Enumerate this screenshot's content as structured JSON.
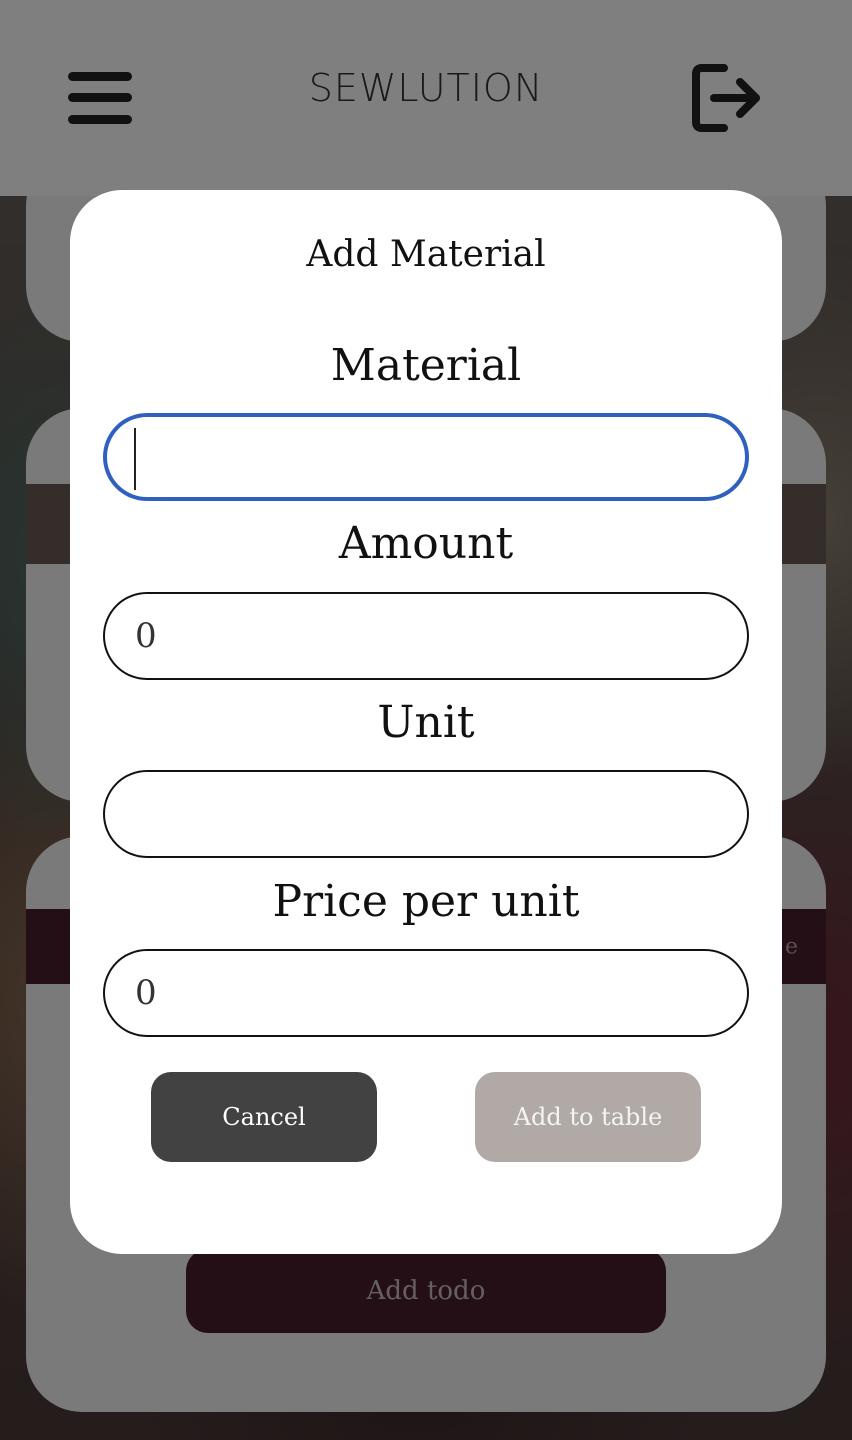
{
  "header": {
    "brand": "SEWLUTION",
    "menu_icon": "hamburger-menu-icon",
    "logout_icon": "logout-icon"
  },
  "background": {
    "band_text_partial": "e",
    "add_todo_label": "Add todo"
  },
  "modal": {
    "title": "Add Material",
    "fields": {
      "material": {
        "label": "Material",
        "value": ""
      },
      "amount": {
        "label": "Amount",
        "value": "0"
      },
      "unit": {
        "label": "Unit",
        "value": ""
      },
      "price": {
        "label": "Price per unit",
        "value": "0"
      }
    },
    "cancel_label": "Cancel",
    "add_label": "Add to table"
  },
  "colors": {
    "focus_border": "#2f5fbf",
    "cancel_bg": "#424242",
    "add_bg": "#b0a9a5",
    "todo_bg": "#4a1f2c"
  }
}
